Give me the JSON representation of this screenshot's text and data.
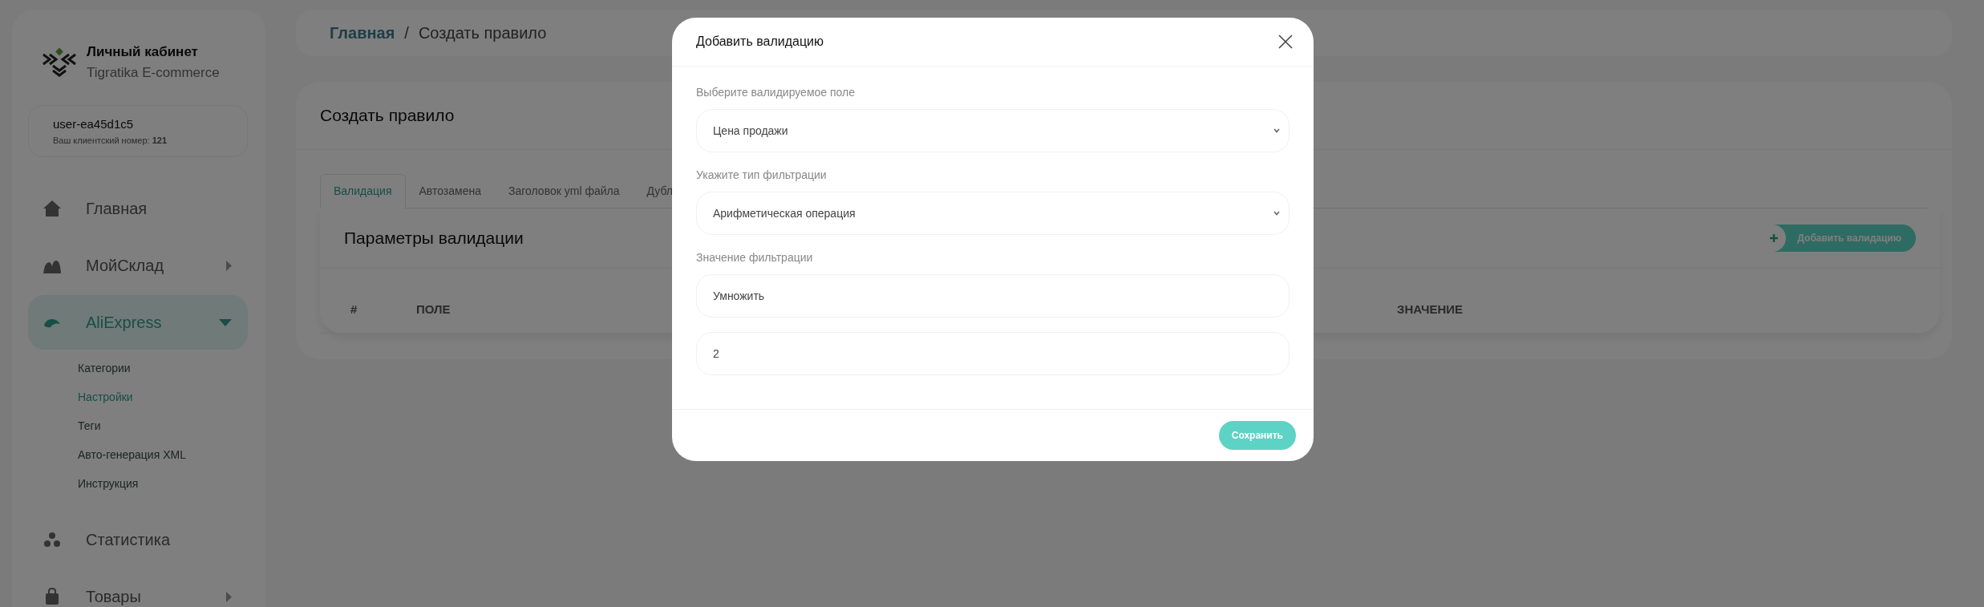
{
  "sidebar": {
    "logo": {
      "title": "Личный кабинет",
      "subtitle": "Tigratika E-commerce"
    },
    "user": {
      "name": "user-ea45d1c5",
      "client_label": "Ваш клиентский номер:",
      "client_number": "121"
    },
    "menu": [
      {
        "label": "Главная",
        "selected": false
      },
      {
        "label": "МойСклад",
        "selected": false,
        "expanded": false
      },
      {
        "label": "AliExpress",
        "selected": true,
        "expanded": true,
        "children": [
          {
            "label": "Категории",
            "selected": false
          },
          {
            "label": "Настройки",
            "selected": true
          },
          {
            "label": "Теги",
            "selected": false
          },
          {
            "label": "Авто-генерация XML",
            "selected": false
          },
          {
            "label": "Инструкция",
            "selected": false
          }
        ]
      },
      {
        "label": "Статистика",
        "selected": false
      },
      {
        "label": "Товары",
        "selected": false,
        "expanded": false
      }
    ]
  },
  "breadcrumb": {
    "items": [
      {
        "label": "Главная",
        "kind": "link"
      },
      {
        "label": "Создать правило",
        "kind": "current"
      }
    ],
    "separator": "/"
  },
  "page": {
    "title": "Создать правило",
    "tabs": [
      {
        "label": "Валидация",
        "selected": true
      },
      {
        "label": "Автозамена",
        "selected": false
      },
      {
        "label": "Заголовок yml файла",
        "selected": false
      },
      {
        "label": "Дубл",
        "selected": false
      }
    ],
    "section_title": "Параметры валидации",
    "add_button": "Добавить валидацию",
    "table": {
      "columns": [
        "#",
        "ПОЛЕ",
        "ЗНАЧЕНИЕ"
      ]
    }
  },
  "modal": {
    "title": "Добавить валидацию",
    "fields": [
      {
        "kind": "select",
        "label": "Выберите валидируемое поле",
        "value": "Цена продажи"
      },
      {
        "kind": "select",
        "label": "Укажите тип фильтрации",
        "value": "Арифметическая операция"
      },
      {
        "kind": "input",
        "label": "Значение фильтрации",
        "value": "Умножить"
      },
      {
        "kind": "input",
        "value": "2"
      }
    ],
    "save_button": "Сохранить"
  }
}
